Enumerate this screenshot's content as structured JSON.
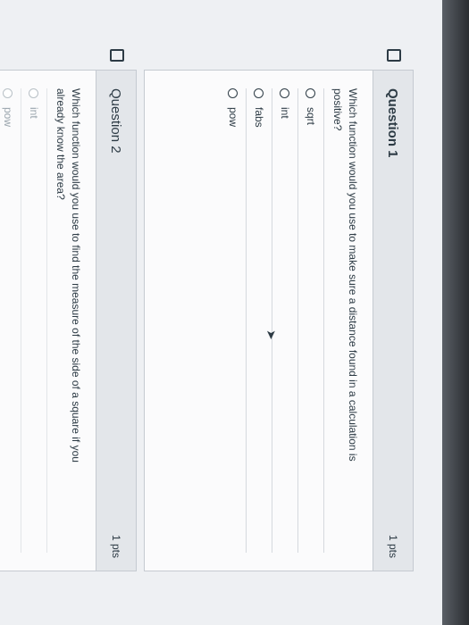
{
  "questions": [
    {
      "title": "Question 1",
      "points": "1 pts",
      "text": "Which function would you use to make sure a distance found in a calculation is positive?",
      "options": [
        "sqrt",
        "int",
        "fabs",
        "pow"
      ]
    },
    {
      "title": "Question 2",
      "points": "1 pts",
      "text": "Which function would you use to find the measure of the side of a square if you already know the area?",
      "options": [
        "int",
        "pow"
      ]
    }
  ],
  "edge_marks": {
    "top": "n",
    "bottom": "0"
  },
  "colors": {
    "text": "#2d3b45",
    "header": "#e3e6ea",
    "border": "#c5cad1"
  }
}
